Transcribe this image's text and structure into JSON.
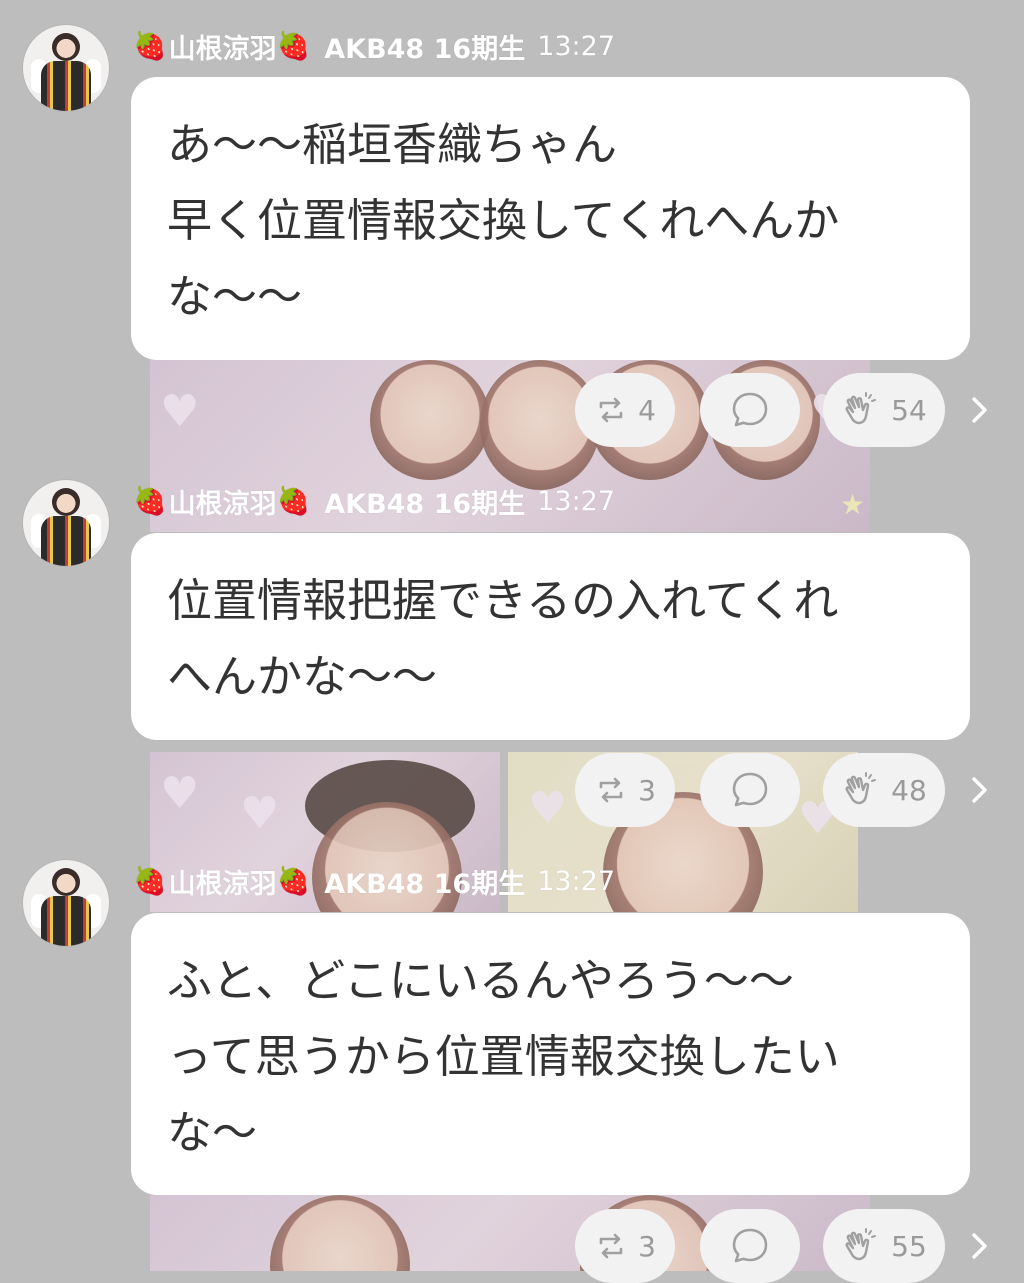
{
  "feed": {
    "posts": [
      {
        "author_name": "山根涼羽",
        "strawberry_left": "🍓",
        "strawberry_right": "🍓",
        "team": "AKB48 16期生",
        "time": "13:27",
        "message_lines": [
          "あ〜〜稲垣香織ちゃん",
          "早く位置情報交換してくれへんか",
          "な〜〜"
        ],
        "retweet_count": "4",
        "like_count": "54"
      },
      {
        "author_name": "山根涼羽",
        "strawberry_left": "🍓",
        "strawberry_right": "🍓",
        "team": "AKB48 16期生",
        "time": "13:27",
        "message_lines": [
          "位置情報把握できるの入れてくれ",
          "へんかな〜〜"
        ],
        "retweet_count": "3",
        "like_count": "48"
      },
      {
        "author_name": "山根涼羽",
        "strawberry_left": "🍓",
        "strawberry_right": "🍓",
        "team": "AKB48 16期生",
        "time": "13:27",
        "message_lines": [
          "ふと、どこにいるんやろう〜〜",
          "って思うから位置情報交換したい",
          "な〜"
        ],
        "retweet_count": "3",
        "like_count": "55"
      }
    ]
  },
  "icons": {
    "retweet": "retweet-icon",
    "comment": "comment-icon",
    "clap": "clap-icon",
    "chevron": "chevron-right-icon",
    "avatar": "avatar"
  },
  "colors": {
    "background": "#bdbdbd",
    "bubble": "#ffffff",
    "pill": "#f2f2f2",
    "icon": "#a0a0a0",
    "name_text": "#ffffff",
    "message_text": "#333333"
  }
}
